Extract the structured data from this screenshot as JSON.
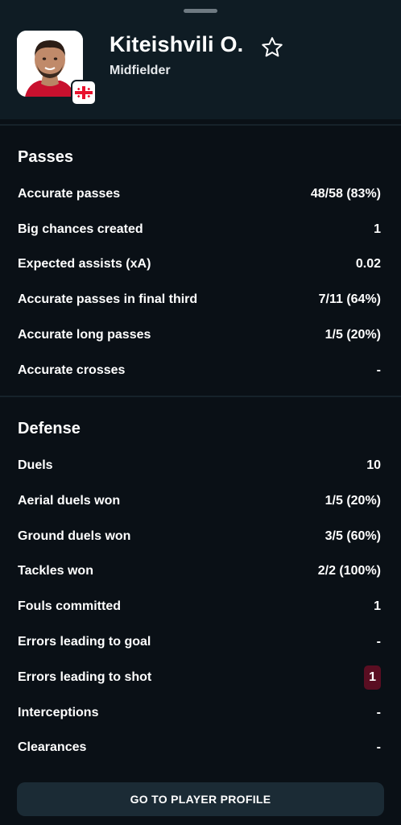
{
  "player": {
    "name": "Kiteishvili O.",
    "position": "Midfielder"
  },
  "passes": {
    "title": "Passes",
    "rows": [
      {
        "label": "Accurate passes",
        "value": "48/58 (83%)"
      },
      {
        "label": "Big chances created",
        "value": "1"
      },
      {
        "label": "Expected assists (xA)",
        "value": "0.02"
      },
      {
        "label": "Accurate passes in final third",
        "value": "7/11 (64%)"
      },
      {
        "label": "Accurate long passes",
        "value": "1/5 (20%)"
      },
      {
        "label": "Accurate crosses",
        "value": "-"
      }
    ]
  },
  "defense": {
    "title": "Defense",
    "rows": [
      {
        "label": "Duels",
        "value": "10"
      },
      {
        "label": "Aerial duels won",
        "value": "1/5 (20%)"
      },
      {
        "label": "Ground duels won",
        "value": "3/5 (60%)"
      },
      {
        "label": "Tackles won",
        "value": "2/2 (100%)"
      },
      {
        "label": "Fouls committed",
        "value": "1"
      },
      {
        "label": "Errors leading to goal",
        "value": "-"
      },
      {
        "label": "Errors leading to shot",
        "value": "1"
      },
      {
        "label": "Interceptions",
        "value": "-"
      },
      {
        "label": "Clearances",
        "value": "-"
      }
    ]
  },
  "profile_button": {
    "label": "GO TO PLAYER PROFILE"
  },
  "colors": {
    "background": "#0a1016",
    "header": "#0f1c24",
    "button": "#1b2b35",
    "error_badge": "#5a0e22"
  },
  "icons": {
    "favorite": "star-outline-icon",
    "nationality": "georgia-flag-icon"
  }
}
